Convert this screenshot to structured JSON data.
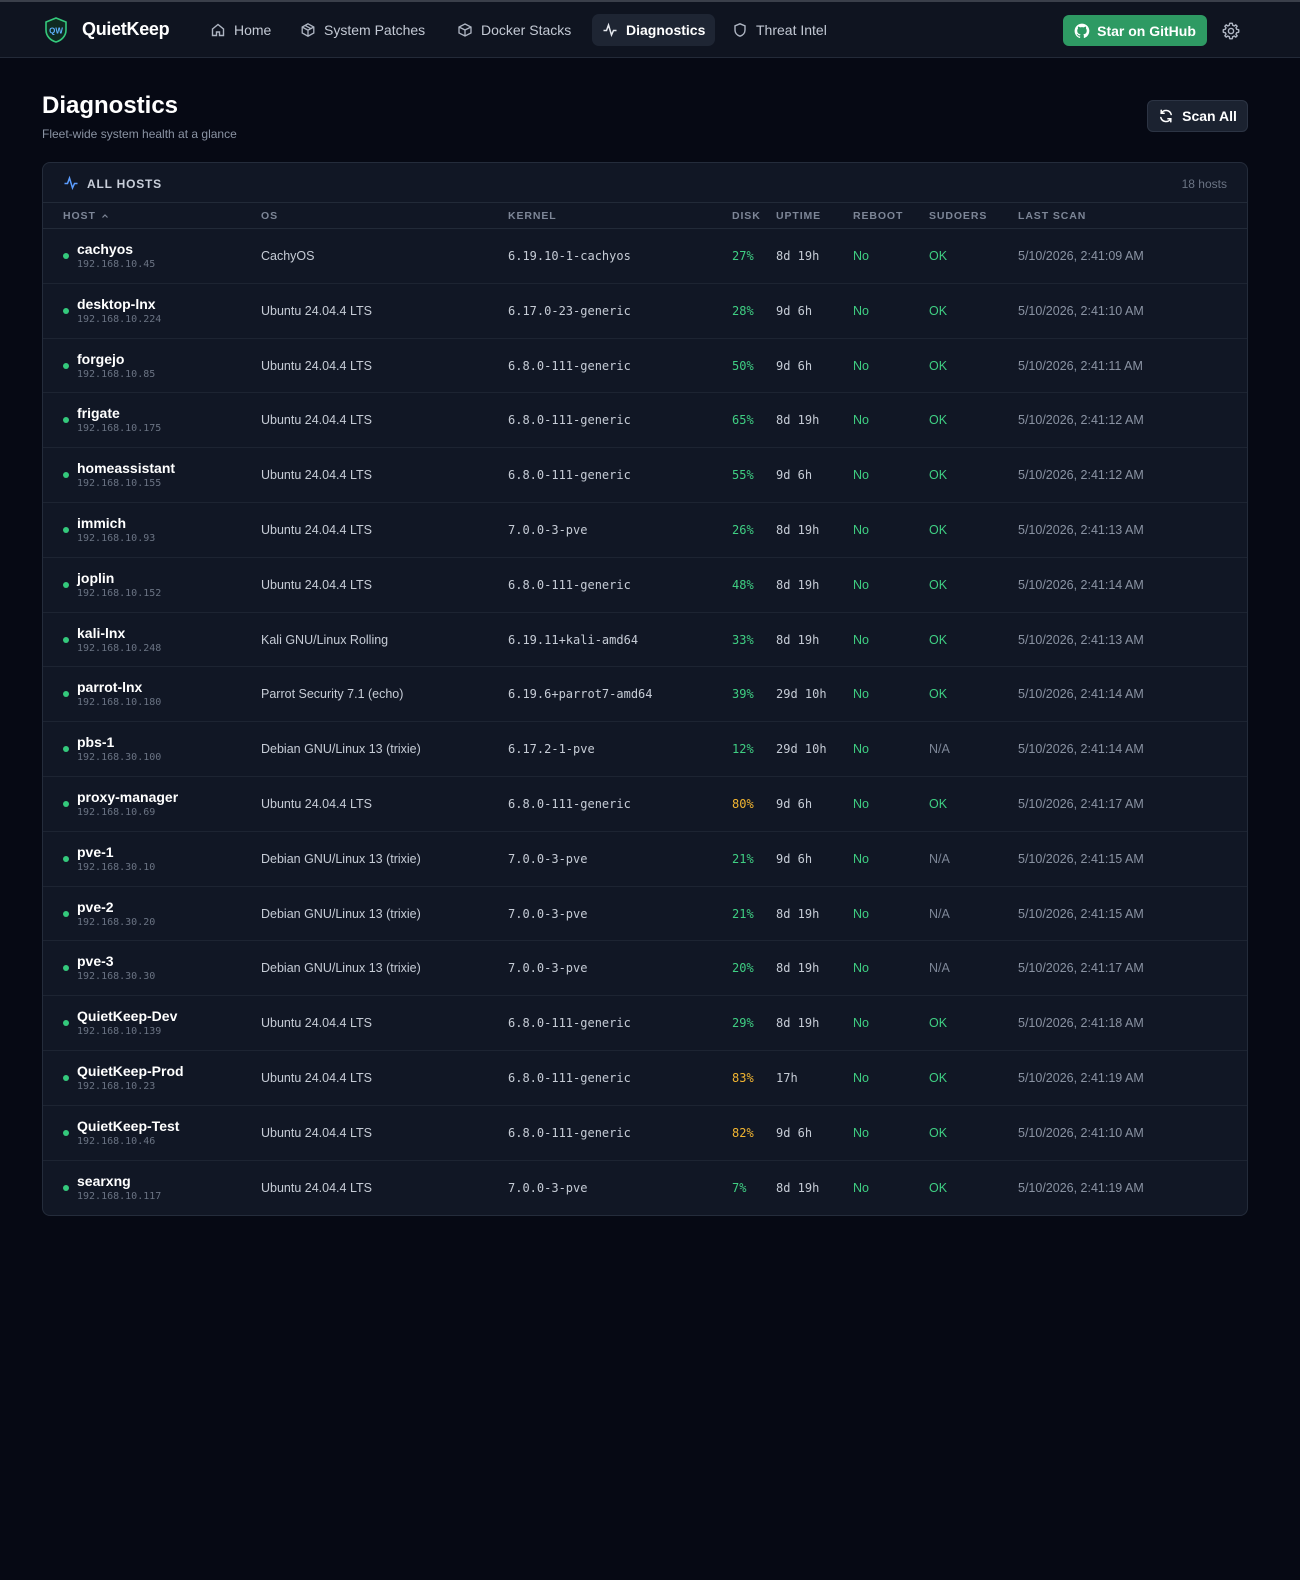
{
  "app": {
    "brand": "QuietKeep",
    "logo_text": "QW"
  },
  "nav": {
    "items": [
      {
        "label": "Home",
        "icon": "home-icon"
      },
      {
        "label": "System Patches",
        "icon": "package-icon"
      },
      {
        "label": "Docker Stacks",
        "icon": "box-icon"
      },
      {
        "label": "Diagnostics",
        "icon": "activity-icon",
        "active": true
      },
      {
        "label": "Threat Intel",
        "icon": "shield-icon"
      }
    ],
    "github_label": "Star on GitHub"
  },
  "header": {
    "title": "Diagnostics",
    "subtitle": "Fleet-wide system health at a glance",
    "scan_all_label": "Scan All"
  },
  "panel": {
    "title": "ALL HOSTS",
    "count": "18 hosts",
    "columns": [
      "HOST",
      "OS",
      "KERNEL",
      "DISK",
      "UPTIME",
      "REBOOT",
      "SUDOERS",
      "LAST SCAN"
    ],
    "rows": [
      {
        "host": "cachyos",
        "ip": "192.168.10.45",
        "os": "CachyOS",
        "kernel": "6.19.10-1-cachyos",
        "disk": "27%",
        "uptime": "8d 19h",
        "reboot": "No",
        "sudoers": "OK",
        "last_scan": "5/10/2026, 2:41:09 AM"
      },
      {
        "host": "desktop-lnx",
        "ip": "192.168.10.224",
        "os": "Ubuntu 24.04.4 LTS",
        "kernel": "6.17.0-23-generic",
        "disk": "28%",
        "uptime": "9d 6h",
        "reboot": "No",
        "sudoers": "OK",
        "last_scan": "5/10/2026, 2:41:10 AM"
      },
      {
        "host": "forgejo",
        "ip": "192.168.10.85",
        "os": "Ubuntu 24.04.4 LTS",
        "kernel": "6.8.0-111-generic",
        "disk": "50%",
        "uptime": "9d 6h",
        "reboot": "No",
        "sudoers": "OK",
        "last_scan": "5/10/2026, 2:41:11 AM"
      },
      {
        "host": "frigate",
        "ip": "192.168.10.175",
        "os": "Ubuntu 24.04.4 LTS",
        "kernel": "6.8.0-111-generic",
        "disk": "65%",
        "uptime": "8d 19h",
        "reboot": "No",
        "sudoers": "OK",
        "last_scan": "5/10/2026, 2:41:12 AM"
      },
      {
        "host": "homeassistant",
        "ip": "192.168.10.155",
        "os": "Ubuntu 24.04.4 LTS",
        "kernel": "6.8.0-111-generic",
        "disk": "55%",
        "uptime": "9d 6h",
        "reboot": "No",
        "sudoers": "OK",
        "last_scan": "5/10/2026, 2:41:12 AM"
      },
      {
        "host": "immich",
        "ip": "192.168.10.93",
        "os": "Ubuntu 24.04.4 LTS",
        "kernel": "7.0.0-3-pve",
        "disk": "26%",
        "uptime": "8d 19h",
        "reboot": "No",
        "sudoers": "OK",
        "last_scan": "5/10/2026, 2:41:13 AM"
      },
      {
        "host": "joplin",
        "ip": "192.168.10.152",
        "os": "Ubuntu 24.04.4 LTS",
        "kernel": "6.8.0-111-generic",
        "disk": "48%",
        "uptime": "8d 19h",
        "reboot": "No",
        "sudoers": "OK",
        "last_scan": "5/10/2026, 2:41:14 AM"
      },
      {
        "host": "kali-lnx",
        "ip": "192.168.10.248",
        "os": "Kali GNU/Linux Rolling",
        "kernel": "6.19.11+kali-amd64",
        "disk": "33%",
        "uptime": "8d 19h",
        "reboot": "No",
        "sudoers": "OK",
        "last_scan": "5/10/2026, 2:41:13 AM"
      },
      {
        "host": "parrot-lnx",
        "ip": "192.168.10.180",
        "os": "Parrot Security 7.1 (echo)",
        "kernel": "6.19.6+parrot7-amd64",
        "disk": "39%",
        "uptime": "29d 10h",
        "reboot": "No",
        "sudoers": "OK",
        "last_scan": "5/10/2026, 2:41:14 AM"
      },
      {
        "host": "pbs-1",
        "ip": "192.168.30.100",
        "os": "Debian GNU/Linux 13 (trixie)",
        "kernel": "6.17.2-1-pve",
        "disk": "12%",
        "uptime": "29d 10h",
        "reboot": "No",
        "sudoers": "N/A",
        "last_scan": "5/10/2026, 2:41:14 AM"
      },
      {
        "host": "proxy-manager",
        "ip": "192.168.10.69",
        "os": "Ubuntu 24.04.4 LTS",
        "kernel": "6.8.0-111-generic",
        "disk": "80%",
        "disk_warn": true,
        "uptime": "9d 6h",
        "reboot": "No",
        "sudoers": "OK",
        "last_scan": "5/10/2026, 2:41:17 AM"
      },
      {
        "host": "pve-1",
        "ip": "192.168.30.10",
        "os": "Debian GNU/Linux 13 (trixie)",
        "kernel": "7.0.0-3-pve",
        "disk": "21%",
        "uptime": "9d 6h",
        "reboot": "No",
        "sudoers": "N/A",
        "last_scan": "5/10/2026, 2:41:15 AM"
      },
      {
        "host": "pve-2",
        "ip": "192.168.30.20",
        "os": "Debian GNU/Linux 13 (trixie)",
        "kernel": "7.0.0-3-pve",
        "disk": "21%",
        "uptime": "8d 19h",
        "reboot": "No",
        "sudoers": "N/A",
        "last_scan": "5/10/2026, 2:41:15 AM"
      },
      {
        "host": "pve-3",
        "ip": "192.168.30.30",
        "os": "Debian GNU/Linux 13 (trixie)",
        "kernel": "7.0.0-3-pve",
        "disk": "20%",
        "uptime": "8d 19h",
        "reboot": "No",
        "sudoers": "N/A",
        "last_scan": "5/10/2026, 2:41:17 AM"
      },
      {
        "host": "QuietKeep-Dev",
        "ip": "192.168.10.139",
        "os": "Ubuntu 24.04.4 LTS",
        "kernel": "6.8.0-111-generic",
        "disk": "29%",
        "uptime": "8d 19h",
        "reboot": "No",
        "sudoers": "OK",
        "last_scan": "5/10/2026, 2:41:18 AM"
      },
      {
        "host": "QuietKeep-Prod",
        "ip": "192.168.10.23",
        "os": "Ubuntu 24.04.4 LTS",
        "kernel": "6.8.0-111-generic",
        "disk": "83%",
        "disk_warn": true,
        "uptime": "17h",
        "reboot": "No",
        "sudoers": "OK",
        "last_scan": "5/10/2026, 2:41:19 AM"
      },
      {
        "host": "QuietKeep-Test",
        "ip": "192.168.10.46",
        "os": "Ubuntu 24.04.4 LTS",
        "kernel": "6.8.0-111-generic",
        "disk": "82%",
        "disk_warn": true,
        "uptime": "9d 6h",
        "reboot": "No",
        "sudoers": "OK",
        "last_scan": "5/10/2026, 2:41:10 AM"
      },
      {
        "host": "searxng",
        "ip": "192.168.10.117",
        "os": "Ubuntu 24.04.4 LTS",
        "kernel": "7.0.0-3-pve",
        "disk": "7%",
        "uptime": "8d 19h",
        "reboot": "No",
        "sudoers": "OK",
        "last_scan": "5/10/2026, 2:41:19 AM"
      }
    ]
  },
  "colors": {
    "background": "#060914",
    "accent_green": "#2e9a63",
    "status_ok": "#3fcf83",
    "status_warn": "#f2b531"
  }
}
